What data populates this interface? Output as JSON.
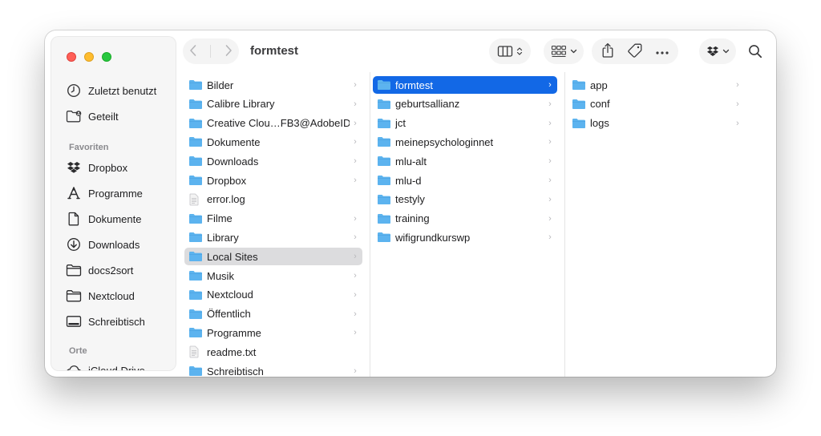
{
  "window": {
    "title": "formtest"
  },
  "sidebar": {
    "recents": [
      {
        "label": "Zuletzt benutzt",
        "icon": "clock-icon"
      },
      {
        "label": "Geteilt",
        "icon": "shared-folder-icon"
      }
    ],
    "favorites_header": "Favoriten",
    "favorites": [
      {
        "label": "Dropbox",
        "icon": "dropbox-icon"
      },
      {
        "label": "Programme",
        "icon": "applications-icon"
      },
      {
        "label": "Dokumente",
        "icon": "document-icon"
      },
      {
        "label": "Downloads",
        "icon": "download-icon"
      },
      {
        "label": "docs2sort",
        "icon": "folder-icon"
      },
      {
        "label": "Nextcloud",
        "icon": "folder-icon"
      },
      {
        "label": "Schreibtisch",
        "icon": "desktop-icon"
      }
    ],
    "locations_header": "Orte",
    "locations": [
      {
        "label": "iCloud Drive",
        "icon": "cloud-icon"
      }
    ]
  },
  "columns": [
    {
      "items": [
        {
          "name": "Bilder",
          "kind": "folder",
          "chevron": true
        },
        {
          "name": "Calibre Library",
          "kind": "folder",
          "chevron": true
        },
        {
          "name": "Creative Clou…FB3@AdobeID",
          "kind": "folder",
          "chevron": true
        },
        {
          "name": "Dokumente",
          "kind": "folder",
          "chevron": true
        },
        {
          "name": "Downloads",
          "kind": "folder",
          "chevron": true
        },
        {
          "name": "Dropbox",
          "kind": "folder",
          "chevron": true
        },
        {
          "name": "error.log",
          "kind": "file",
          "chevron": false
        },
        {
          "name": "Filme",
          "kind": "folder",
          "chevron": true
        },
        {
          "name": "Library",
          "kind": "folder",
          "chevron": true
        },
        {
          "name": "Local Sites",
          "kind": "folder",
          "chevron": true,
          "state": "highlight"
        },
        {
          "name": "Musik",
          "kind": "folder",
          "chevron": true
        },
        {
          "name": "Nextcloud",
          "kind": "folder",
          "chevron": true
        },
        {
          "name": "Öffentlich",
          "kind": "folder",
          "chevron": true
        },
        {
          "name": "Programme",
          "kind": "folder",
          "chevron": true
        },
        {
          "name": "readme.txt",
          "kind": "file",
          "chevron": false
        },
        {
          "name": "Schreibtisch",
          "kind": "folder",
          "chevron": true
        }
      ]
    },
    {
      "items": [
        {
          "name": "formtest",
          "kind": "folder",
          "chevron": true,
          "state": "selected"
        },
        {
          "name": "geburtsallianz",
          "kind": "folder",
          "chevron": true
        },
        {
          "name": "jct",
          "kind": "folder",
          "chevron": true
        },
        {
          "name": "meinepsychologinnet",
          "kind": "folder",
          "chevron": true
        },
        {
          "name": "mlu-alt",
          "kind": "folder",
          "chevron": true
        },
        {
          "name": "mlu-d",
          "kind": "folder",
          "chevron": true
        },
        {
          "name": "testyly",
          "kind": "folder",
          "chevron": true
        },
        {
          "name": "training",
          "kind": "folder",
          "chevron": true
        },
        {
          "name": "wifigrundkurswp",
          "kind": "folder",
          "chevron": true
        }
      ]
    },
    {
      "items": [
        {
          "name": "app",
          "kind": "folder",
          "chevron": true
        },
        {
          "name": "conf",
          "kind": "folder",
          "chevron": true
        },
        {
          "name": "logs",
          "kind": "folder",
          "chevron": true
        }
      ]
    }
  ],
  "colors": {
    "selection": "#1268e6",
    "highlight": "#dcdcde",
    "folder": "#5cb3ee",
    "sidebar_bg": "#f6f6f6"
  }
}
